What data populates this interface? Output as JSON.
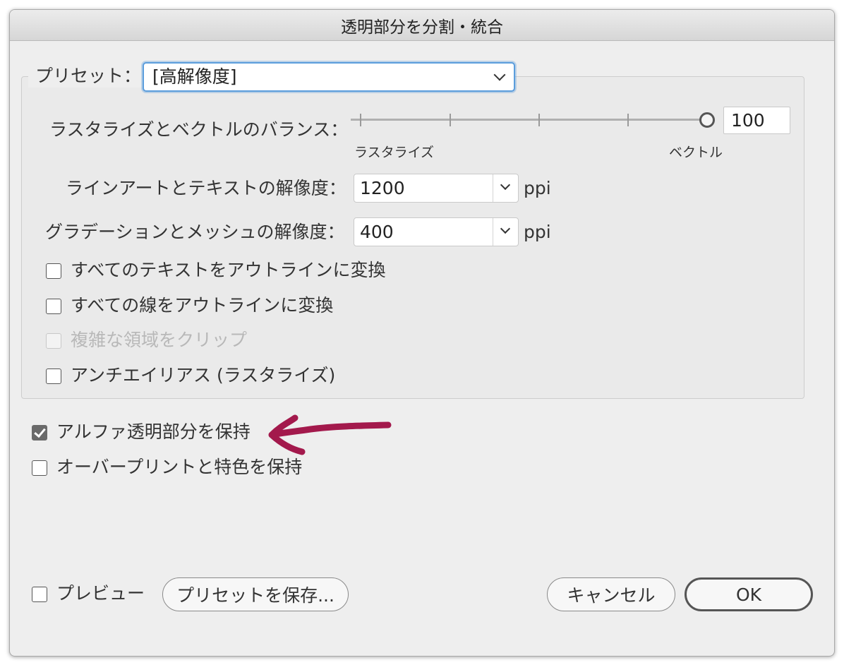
{
  "window": {
    "title": "透明部分を分割・統合"
  },
  "preset": {
    "label": "プリセット：",
    "value": "[高解像度]"
  },
  "balance": {
    "label": "ラスタライズとベクトルのバランス：",
    "left_label": "ラスタライズ",
    "right_label": "ベクトル",
    "value": "100",
    "level_percent": 100
  },
  "line_art_res": {
    "label": "ラインアートとテキストの解像度：",
    "value": "1200",
    "unit": "ppi"
  },
  "gradient_res": {
    "label": "グラデーションとメッシュの解像度：",
    "value": "400",
    "unit": "ppi"
  },
  "options": [
    {
      "label": "すべてのテキストをアウトラインに変換",
      "checked": false,
      "disabled": false
    },
    {
      "label": "すべての線をアウトラインに変換",
      "checked": false,
      "disabled": false
    },
    {
      "label": "複雑な領域をクリップ",
      "checked": false,
      "disabled": true
    },
    {
      "label": "アンチエイリアス (ラスタライズ)",
      "checked": false,
      "disabled": false
    }
  ],
  "alpha": {
    "label": "アルファ透明部分を保持",
    "checked": true
  },
  "overprint": {
    "label": "オーバープリントと特色を保持",
    "checked": false
  },
  "preview": {
    "label": "プレビュー",
    "checked": false
  },
  "buttons": {
    "save_preset": "プリセットを保存...",
    "cancel": "キャンセル",
    "ok": "OK"
  },
  "annotation": {
    "arrow_color": "#a3194c"
  },
  "colors": {
    "focus_ring": "#5b9ddc"
  }
}
